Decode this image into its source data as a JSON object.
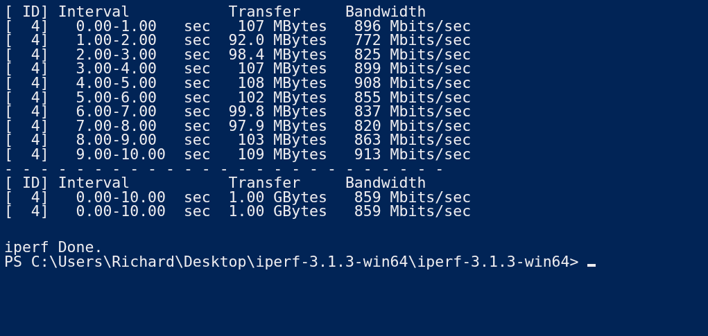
{
  "terminal": {
    "lines": [
      "[ ID] Interval           Transfer     Bandwidth",
      "[  4]   0.00-1.00   sec   107 MBytes   896 Mbits/sec",
      "[  4]   1.00-2.00   sec  92.0 MBytes   772 Mbits/sec",
      "[  4]   2.00-3.00   sec  98.4 MBytes   825 Mbits/sec",
      "[  4]   3.00-4.00   sec   107 MBytes   899 Mbits/sec",
      "[  4]   4.00-5.00   sec   108 MBytes   908 Mbits/sec",
      "[  4]   5.00-6.00   sec   102 MBytes   855 Mbits/sec",
      "[  4]   6.00-7.00   sec  99.8 MBytes   837 Mbits/sec",
      "[  4]   7.00-8.00   sec  97.9 MBytes   820 Mbits/sec",
      "[  4]   8.00-9.00   sec   103 MBytes   863 Mbits/sec",
      "[  4]   9.00-10.00  sec   109 MBytes   913 Mbits/sec",
      "- - - - - - - - - - - - - - - - - - - - - - - - -",
      "[ ID] Interval           Transfer     Bandwidth",
      "[  4]   0.00-10.00  sec  1.00 GBytes   859 Mbits/sec",
      "[  4]   0.00-10.00  sec  1.00 GBytes   859 Mbits/sec"
    ],
    "footer_lines": [
      "iperf Done.",
      "PS C:\\Users\\Richard\\Desktop\\iperf-3.1.3-win64\\iperf-3.1.3-win64> "
    ],
    "cursor_visible": true
  }
}
